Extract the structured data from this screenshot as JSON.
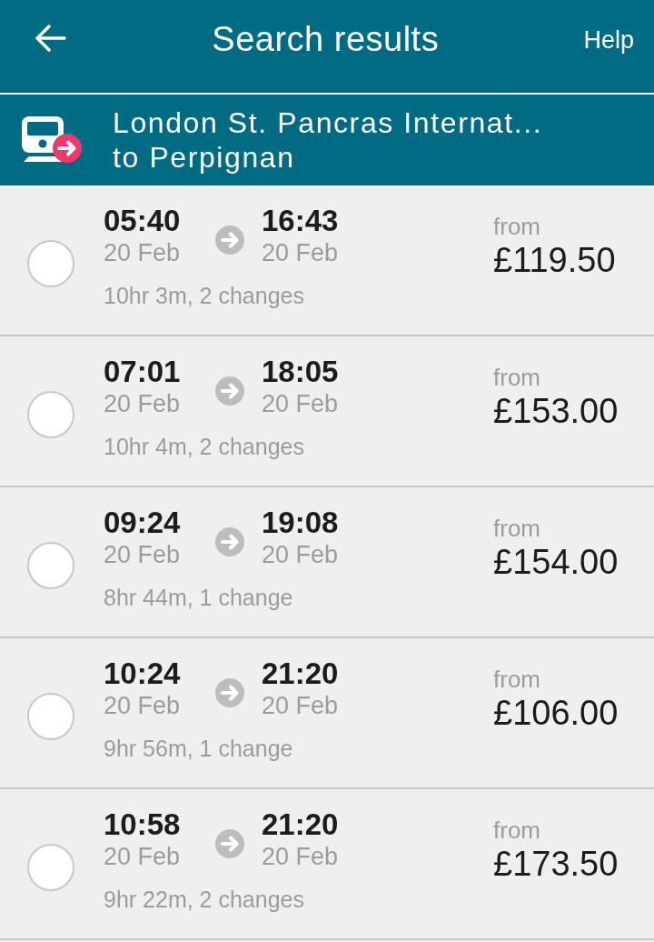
{
  "header": {
    "title": "Search results",
    "help": "Help"
  },
  "route": {
    "origin": "London St. Pancras Internat...",
    "destination": "to Perpignan"
  },
  "journeys": [
    {
      "selected": false,
      "depart_time": "05:40",
      "depart_date": "20 Feb",
      "arrive_time": "16:43",
      "arrive_date": "20 Feb",
      "summary": "10hr 3m, 2 changes",
      "price_label": "from",
      "price": "£119.50"
    },
    {
      "selected": false,
      "depart_time": "07:01",
      "depart_date": "20 Feb",
      "arrive_time": "18:05",
      "arrive_date": "20 Feb",
      "summary": "10hr 4m, 2 changes",
      "price_label": "from",
      "price": "£153.00"
    },
    {
      "selected": false,
      "depart_time": "09:24",
      "depart_date": "20 Feb",
      "arrive_time": "19:08",
      "arrive_date": "20 Feb",
      "summary": "8hr 44m, 1 change",
      "price_label": "from",
      "price": "£154.00"
    },
    {
      "selected": false,
      "depart_time": "10:24",
      "depart_date": "20 Feb",
      "arrive_time": "21:20",
      "arrive_date": "20 Feb",
      "summary": "9hr 56m, 1 change",
      "price_label": "from",
      "price": "£106.00"
    },
    {
      "selected": false,
      "depart_time": "10:58",
      "depart_date": "20 Feb",
      "arrive_time": "21:20",
      "arrive_date": "20 Feb",
      "summary": "9hr 22m, 2 changes",
      "price_label": "from",
      "price": "£173.50"
    }
  ]
}
